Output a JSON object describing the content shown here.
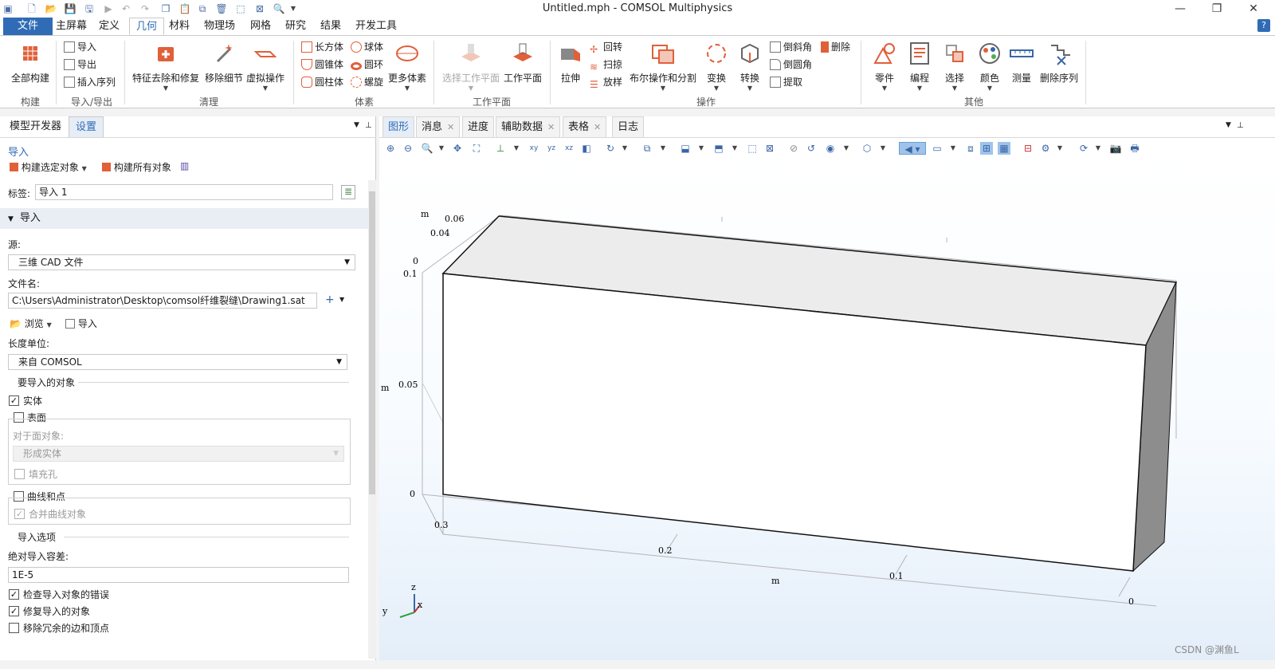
{
  "window": {
    "title": "Untitled.mph - COMSOL Multiphysics"
  },
  "menu": {
    "file": "文件",
    "home": "主屏幕",
    "definitions": "定义",
    "geometry": "几何",
    "materials": "材料",
    "physics": "物理场",
    "mesh": "网格",
    "study": "研究",
    "results": "结果",
    "developer": "开发工具",
    "help": "?"
  },
  "ribbon": {
    "build_all": "全部构建",
    "import": "导入",
    "export": "导出",
    "insert_sequence": "插入序列",
    "defeaturing": "特征去除和修复",
    "remove_details": "移除细节",
    "virtual_ops": "虚拟操作",
    "block": "长方体",
    "cone": "圆锥体",
    "cylinder": "圆柱体",
    "sphere": "球体",
    "torus": "圆环",
    "helix": "螺旋",
    "more_primitives": "更多体素",
    "select_work_plane": "选择工作平面",
    "work_plane": "工作平面",
    "extrude": "拉伸",
    "revolve": "回转",
    "sweep": "扫掠",
    "loft": "放样",
    "booleans": "布尔操作和分割",
    "transforms": "变换",
    "conversions": "转换",
    "chamfer": "倒斜角",
    "fillet": "倒圆角",
    "extract": "提取",
    "delete": "删除",
    "parts": "零件",
    "programming": "编程",
    "selections": "选择",
    "colors": "颜色",
    "measure": "测量",
    "delete_sequence": "删除序列",
    "groups": {
      "build": "构建",
      "import_export": "导入/导出",
      "cleanup": "清理",
      "primitives": "体素",
      "work_plane": "工作平面",
      "operations": "操作",
      "other": "其他"
    }
  },
  "left": {
    "tab_model_builder": "模型开发器",
    "tab_settings": "设置",
    "node_title": "导入",
    "build_selected": "构建选定对象",
    "build_all_objects": "构建所有对象",
    "label_caption": "标签:",
    "label_value": "导入 1",
    "section_import": "导入",
    "source_caption": "源:",
    "source_value": "三维 CAD 文件",
    "filename_caption": "文件名:",
    "filename_value": "C:\\Users\\Administrator\\Desktop\\comsol纤维裂缝\\Drawing1.sat",
    "browse": "浏览",
    "import_button": "导入",
    "length_unit_caption": "长度单位:",
    "length_unit_value": "来自 COMSOL",
    "objects_to_import": "要导入的对象",
    "solids": "实体",
    "surfaces": "表面",
    "for_surface_objects": "对于面对象:",
    "form_solids": "形成实体",
    "fill_holes": "填充孔",
    "curves_points": "曲线和点",
    "merge_curves": "合并曲线对象",
    "import_options": "导入选项",
    "abs_tolerance_caption": "绝对导入容差:",
    "abs_tolerance_value": "1E-5",
    "check_errors": "检查导入对象的错误",
    "repair_objects": "修复导入的对象",
    "remove_redundant": "移除冗余的边和顶点"
  },
  "right": {
    "tabs": [
      {
        "label": "图形",
        "closable": false
      },
      {
        "label": "消息",
        "closable": true
      },
      {
        "label": "进度",
        "closable": false
      },
      {
        "label": "辅助数据",
        "closable": true
      },
      {
        "label": "表格",
        "closable": true
      },
      {
        "label": "日志",
        "closable": false
      }
    ],
    "axes": {
      "unit": "m",
      "y_ticks": [
        "0.06",
        "0.04",
        "0"
      ],
      "z_ticks": [
        "0.1",
        "0.05",
        "0"
      ],
      "x_ticks": [
        "0.3",
        "0.2",
        "0.1",
        "0"
      ],
      "triad_z": "z",
      "triad_x": "x",
      "triad_y": "y"
    }
  },
  "watermark": "CSDN @渊鱼L",
  "colors": {
    "accent": "#2f6cb5",
    "icon_orange": "#e0603a",
    "icon_blue": "#3a66a8"
  }
}
